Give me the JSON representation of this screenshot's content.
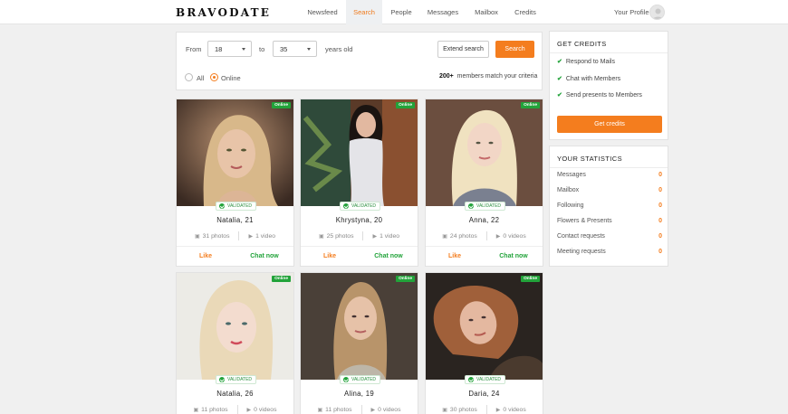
{
  "brand": "BRAVODATE",
  "nav": {
    "items": [
      "Newsfeed",
      "Search",
      "People",
      "Messages",
      "Mailbox",
      "Credits"
    ],
    "active": "Search",
    "profile_label": "Your Profile"
  },
  "search": {
    "from_label": "From",
    "from_value": "18",
    "to_label": "to",
    "to_value": "35",
    "years_label": "years old",
    "extend_label": "Extend search",
    "search_label": "Search",
    "radio_all": "All",
    "radio_online": "Online",
    "selected_radio": "Online",
    "match_count": "200+",
    "match_text": "members match your criteria"
  },
  "profiles": [
    {
      "name": "Natalia, 21",
      "photos": "31 photos",
      "videos": "1 video",
      "online": "Online",
      "validated": "VALIDATED",
      "like": "Like",
      "chat": "Chat now"
    },
    {
      "name": "Khrystyna, 20",
      "photos": "25 photos",
      "videos": "1 video",
      "online": "Online",
      "validated": "VALIDATED",
      "like": "Like",
      "chat": "Chat now"
    },
    {
      "name": "Anna, 22",
      "photos": "24 photos",
      "videos": "0 videos",
      "online": "Online",
      "validated": "VALIDATED",
      "like": "Like",
      "chat": "Chat now"
    },
    {
      "name": "Natalia, 26",
      "photos": "11 photos",
      "videos": "0 videos",
      "online": "Online",
      "validated": "VALIDATED"
    },
    {
      "name": "Alina, 19",
      "photos": "11 photos",
      "videos": "0 videos",
      "online": "Online",
      "validated": "VALIDATED"
    },
    {
      "name": "Daria, 24",
      "photos": "30 photos",
      "videos": "0 videos",
      "online": "Online",
      "validated": "VALIDATED"
    }
  ],
  "credits": {
    "title": "GET CREDITS",
    "items": [
      "Respond to Mails",
      "Chat with Members",
      "Send presents to Members"
    ],
    "button": "Get credits"
  },
  "statistics": {
    "title": "YOUR STATISTICS",
    "rows": [
      {
        "label": "Messages",
        "value": "0"
      },
      {
        "label": "Mailbox",
        "value": "0"
      },
      {
        "label": "Following",
        "value": "0"
      },
      {
        "label": "Flowers & Presents",
        "value": "0"
      },
      {
        "label": "Contact requests",
        "value": "0"
      },
      {
        "label": "Meeting requests",
        "value": "0"
      }
    ]
  },
  "colors": {
    "accent": "#f47d1e",
    "online_green": "#22a33a"
  }
}
